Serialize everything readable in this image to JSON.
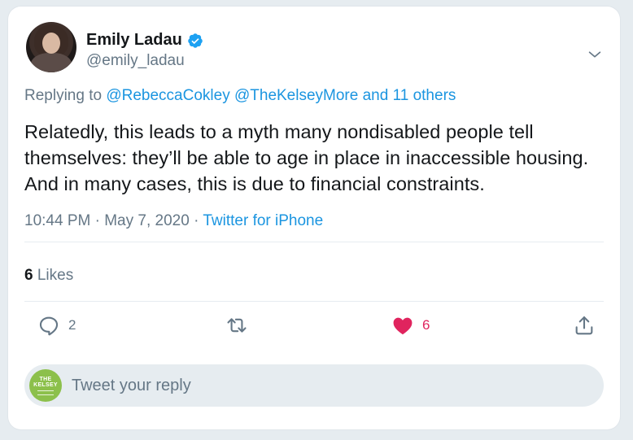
{
  "author": {
    "name": "Emily Ladau",
    "handle": "@emily_ladau",
    "verified": true
  },
  "reply_context": {
    "prefix": "Replying to",
    "mention_1": "@RebeccaCokley",
    "mention_2": "@TheKelseyMore",
    "others": "and 11 others"
  },
  "tweet": {
    "text": "Relatedly, this leads to a myth many nondisabled people tell themselves: they’ll be able to age in place in inaccessible housing. And in many cases, this is due to financial constraints.",
    "time": "10:44 PM",
    "separator_1": "·",
    "date": "May 7, 2020",
    "separator_2": "·",
    "source": "Twitter for iPhone"
  },
  "stats": {
    "likes_count": "6",
    "likes_label": "Likes"
  },
  "actions": {
    "reply_count": "2",
    "retweet_count": "",
    "like_count": "6"
  },
  "reply_box": {
    "placeholder": "Tweet your reply",
    "avatar_text_1": "THE",
    "avatar_text_2": "KELSEY"
  },
  "colors": {
    "accent": "#1b95e0",
    "like": "#e0245e",
    "muted": "#657786",
    "text": "#14171a",
    "kelsey_green": "#8cc04b"
  },
  "icons": {
    "verified": "verified-badge-icon",
    "menu": "chevron-down-icon",
    "reply": "reply-bubble-icon",
    "retweet": "retweet-icon",
    "like": "heart-icon",
    "share": "share-icon"
  }
}
